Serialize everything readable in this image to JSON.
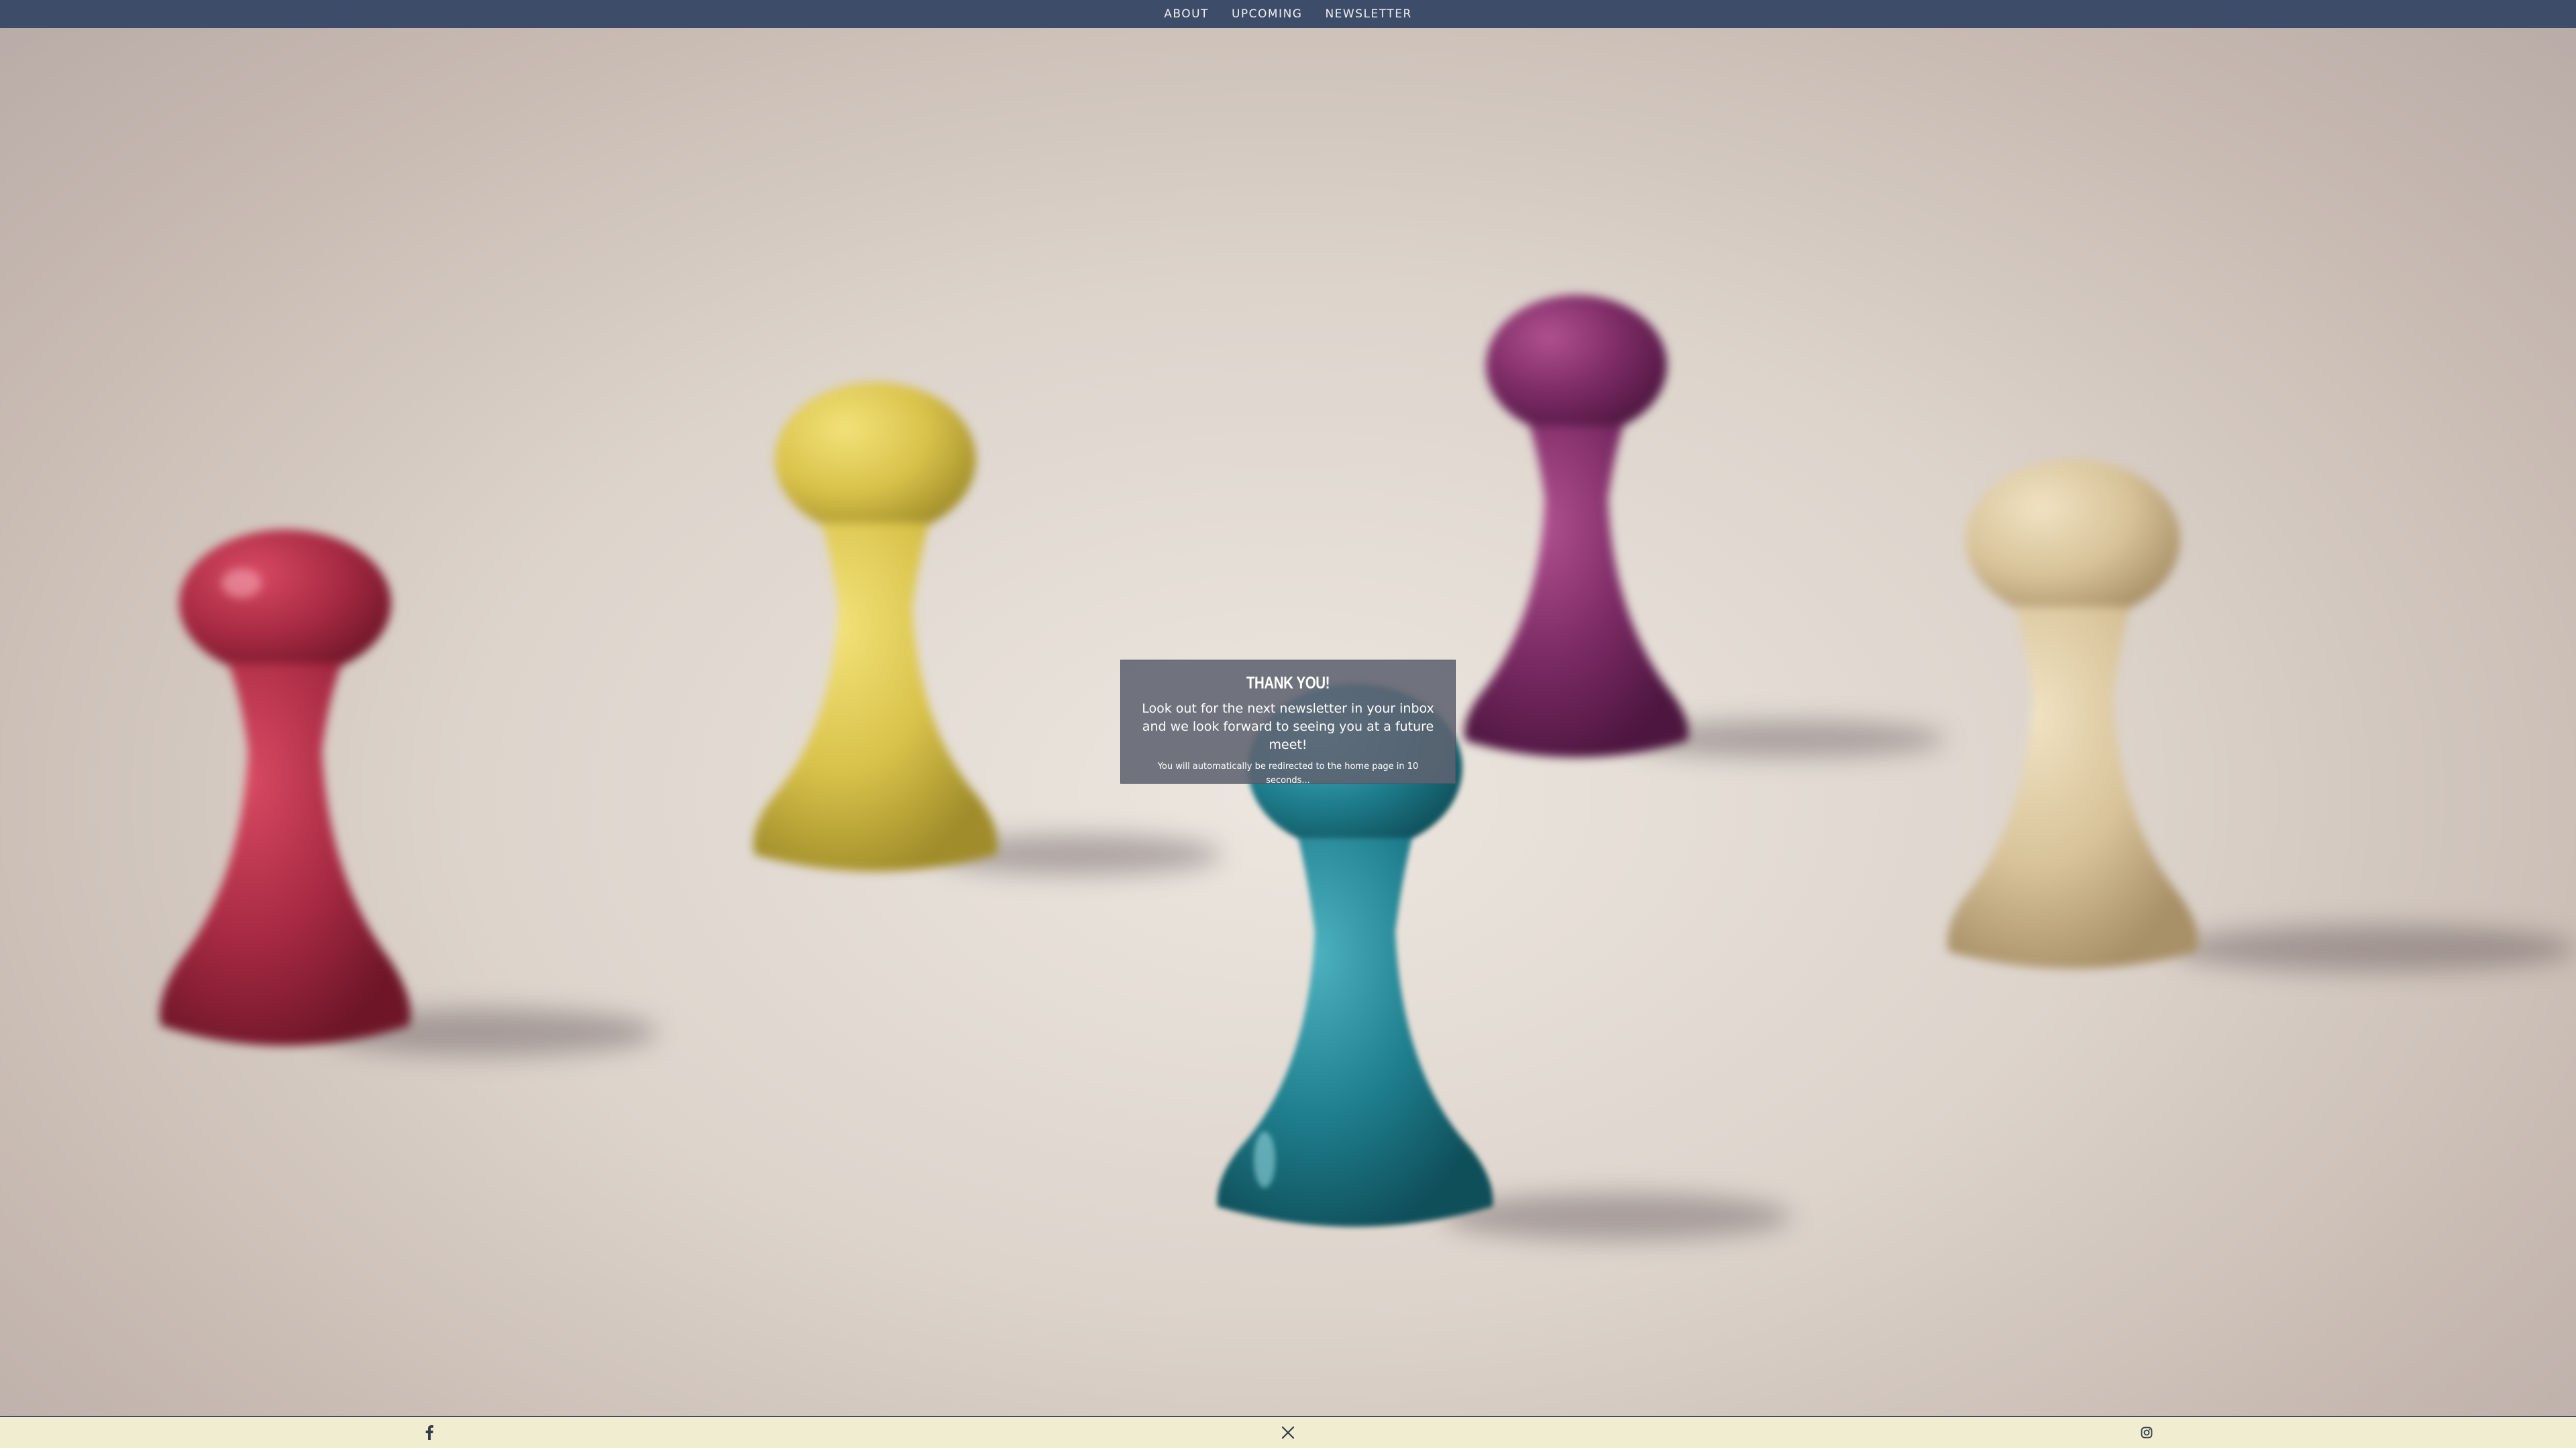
{
  "nav": {
    "items": [
      {
        "label": "ABOUT"
      },
      {
        "label": "UPCOMING"
      },
      {
        "label": "NEWSLETTER"
      }
    ],
    "background": "#3d4d69"
  },
  "modal": {
    "title": "THANK YOU!",
    "message": "Look out for the next newsletter in your inbox and we look forward to seeing you at a future meet!",
    "redirect_text": "You will automatically be redirected to the home page in 10 seconds..."
  },
  "footer": {
    "background": "#f1edd0",
    "social": [
      {
        "icon": "facebook-icon"
      },
      {
        "icon": "x-icon"
      },
      {
        "icon": "instagram-icon"
      }
    ]
  },
  "background_image": {
    "subject": "wooden game pawns",
    "colors": [
      "#a82a44",
      "#d9c24a",
      "#7a2a63",
      "#d8c39a",
      "#1f7f8e"
    ]
  }
}
